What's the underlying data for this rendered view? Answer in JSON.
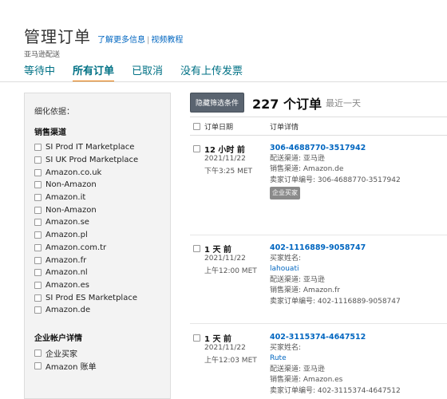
{
  "header": {
    "title": "管理订单",
    "learn_more": "了解更多信息",
    "separator": "|",
    "video": "视频教程",
    "subtitle": "亚马逊配送"
  },
  "tabs": [
    "等待中",
    "所有订单",
    "已取消",
    "没有上传发票"
  ],
  "active_tab": "所有订单",
  "sidebar": {
    "heading": "细化依据：",
    "channel_title": "销售渠道",
    "channels": [
      "SI Prod IT Marketplace",
      "SI UK Prod Marketplace",
      "Amazon.co.uk",
      "Non-Amazon",
      "Amazon.it",
      "Non-Amazon",
      "Amazon.se",
      "Amazon.pl",
      "Amazon.com.tr",
      "Amazon.fr",
      "Amazon.nl",
      "Amazon.es",
      "SI Prod ES Marketplace",
      "Amazon.de"
    ],
    "business_title": "企业帐户详情",
    "business": [
      "企业买家",
      "Amazon 账单"
    ]
  },
  "toolbar": {
    "hide_filters": "隐藏筛选条件",
    "count": "227 个订单",
    "range": "最近一天"
  },
  "table": {
    "col_date": "订单日期",
    "col_detail": "订单详情"
  },
  "orders": [
    {
      "age": "12 小时 前",
      "date": "2021/11/22",
      "time": "下午3:25 MET",
      "id": "306-4688770-3517942",
      "ship": "配送渠道: 亚马逊",
      "channel": "销售渠道: Amazon.de",
      "seller_id": "卖家订单编号: 306-4688770-3517942",
      "badge": "企业买家"
    },
    {
      "age": "1 天 前",
      "date": "2021/11/22",
      "time": "上午12:00 MET",
      "id": "402-1116889-9058747",
      "buyer_label": "买家姓名:",
      "buyer": "lahouati",
      "ship": "配送渠道: 亚马逊",
      "channel": "销售渠道: Amazon.fr",
      "seller_id": "卖家订单编号: 402-1116889-9058747"
    },
    {
      "age": "1 天 前",
      "date": "2021/11/22",
      "time": "上午12:03 MET",
      "id": "402-3115374-4647512",
      "buyer_label": "买家姓名:",
      "buyer": "Rute",
      "ship": "配送渠道: 亚马逊",
      "channel": "销售渠道: Amazon.es",
      "seller_id": "卖家订单编号: 402-3115374-4647512"
    }
  ]
}
